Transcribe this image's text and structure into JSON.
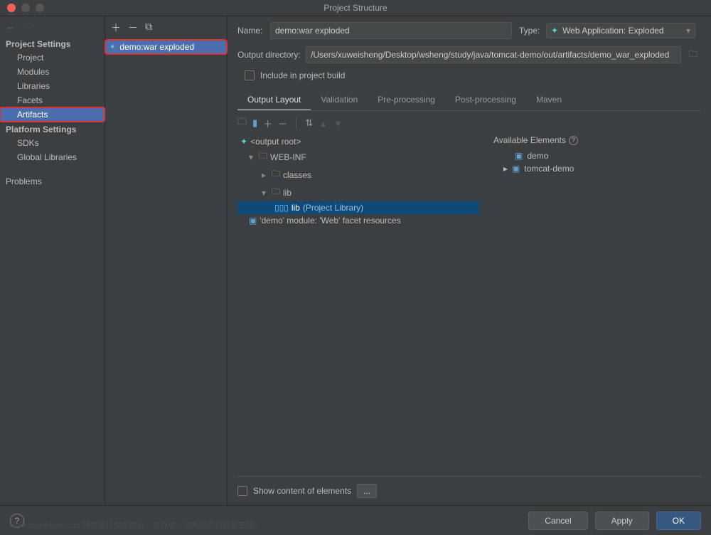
{
  "window": {
    "title": "Project Structure"
  },
  "sidebar": {
    "projectSettingsHeader": "Project Settings",
    "platformSettingsHeader": "Platform Settings",
    "items": {
      "project": "Project",
      "modules": "Modules",
      "libraries": "Libraries",
      "facets": "Facets",
      "artifacts": "Artifacts",
      "sdks": "SDKs",
      "globalLibs": "Global Libraries",
      "problems": "Problems"
    }
  },
  "artifacts": {
    "list": [
      {
        "label": "demo:war exploded"
      }
    ]
  },
  "detail": {
    "nameLabel": "Name:",
    "nameValue": "demo:war exploded",
    "typeLabel": "Type:",
    "typeValue": "Web Application: Exploded",
    "outputDirLabel": "Output directory:",
    "outputDirValue": "/Users/xuweisheng/Desktop/wsheng/study/java/tomcat-demo/out/artifacts/demo_war_exploded",
    "includeBuild": "Include in project build",
    "tabs": {
      "outputLayout": "Output Layout",
      "validation": "Validation",
      "preProcessing": "Pre-processing",
      "postProcessing": "Post-processing",
      "maven": "Maven"
    },
    "tree": {
      "root": "<output root>",
      "webinf": "WEB-INF",
      "classes": "classes",
      "lib": "lib",
      "libProject": "lib",
      "libProjectSuffix": "(Project Library)",
      "demoFacet": "'demo' module: 'Web' facet resources"
    },
    "available": {
      "header": "Available Elements",
      "demo": "demo",
      "tomcatDemo": "tomcat-demo"
    },
    "showContent": "Show content of elements",
    "ellipsis": "..."
  },
  "buttons": {
    "cancel": "Cancel",
    "apply": "Apply",
    "ok": "OK"
  },
  "watermark": "www.toymoban.com 网络图片仅供展示，非存储，如有侵权请联系删除。"
}
